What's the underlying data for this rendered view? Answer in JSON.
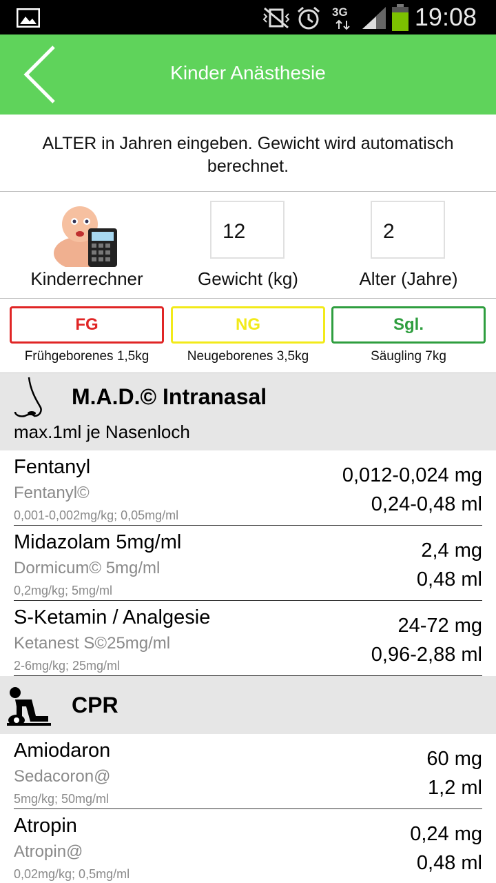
{
  "status": {
    "time": "19:08",
    "network": "3G"
  },
  "header": {
    "title": "Kinder Anästhesie"
  },
  "instruction": "ALTER in Jahren eingeben. Gewicht wird automatisch berechnet.",
  "inputs": {
    "calculator_label": "Kinderrechner",
    "weight_value": "12",
    "weight_label": "Gewicht (kg)",
    "age_value": "2",
    "age_label": "Alter (Jahre)"
  },
  "categories": [
    {
      "code": "FG",
      "label": "Frühgeborenes 1,5kg",
      "color": "#e02525"
    },
    {
      "code": "NG",
      "label": "Neugeborenes 3,5kg",
      "color": "#f2ea1a"
    },
    {
      "code": "Sgl.",
      "label": "Säugling 7kg",
      "color": "#2f9e3f"
    }
  ],
  "sections": {
    "mad": {
      "title": "M.A.D.© Intranasal",
      "subtitle": "max.1ml je Nasenloch",
      "drugs": [
        {
          "name": "Fentanyl",
          "brand": "Fentanyl©",
          "dose": "0,001-0,002mg/kg; 0,05mg/ml",
          "mg": "0,012-0,024 mg",
          "ml": "0,24-0,48 ml"
        },
        {
          "name": "Midazolam 5mg/ml",
          "brand": "Dormicum© 5mg/ml",
          "dose": "0,2mg/kg; 5mg/ml",
          "mg": "2,4 mg",
          "ml": "0,48 ml"
        },
        {
          "name": "S-Ketamin / Analgesie",
          "brand": "Ketanest S©25mg/ml",
          "dose": "2-6mg/kg; 25mg/ml",
          "mg": "24-72 mg",
          "ml": "0,96-2,88 ml"
        }
      ]
    },
    "cpr": {
      "title": "CPR",
      "drugs": [
        {
          "name": "Amiodaron",
          "brand": "Sedacoron@",
          "dose": "5mg/kg; 50mg/ml",
          "mg": "60 mg",
          "ml": "1,2 ml"
        },
        {
          "name": "Atropin",
          "brand": "Atropin@",
          "dose": "0,02mg/kg; 0,5mg/ml",
          "mg": "0,24 mg",
          "ml": "0,48 ml"
        }
      ]
    }
  }
}
